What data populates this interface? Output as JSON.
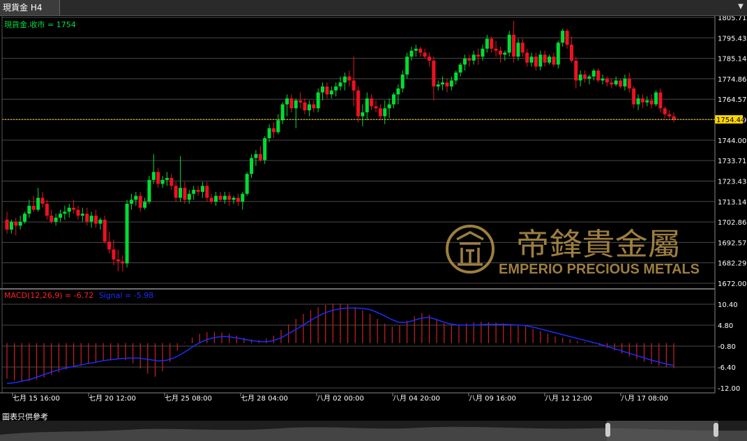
{
  "tab": {
    "title": "現貨金 H4",
    "scroll_icon": "chevron-down-icon"
  },
  "main_panel": {
    "legend": "現貨金.收市 = 1754",
    "current_price": "1754.44"
  },
  "macd_panel": {
    "macd_label": "MACD(12,26,9) = -6.72",
    "signal_label": "Signal = -5.98"
  },
  "watermark": {
    "chinese": "帝鋒貴金屬",
    "english": "EMPERIO PRECIOUS METALS",
    "logo_icon": "emperio-logo-icon"
  },
  "footer": {
    "label": "圖表只供參考"
  },
  "colors": {
    "up": "#00dd33",
    "down": "#ee1122",
    "grid": "#4a4a4a",
    "axis_text": "#ffffff",
    "price_tag": "#ffd700",
    "signal": "#1a2eff",
    "histogram": "#cc2222",
    "legend_main": "#00e040",
    "legend_macd": "#ff2020",
    "gold": "#b8944a"
  },
  "chart_data": [
    {
      "type": "candlestick",
      "title": "現貨金 H4",
      "ylim": [
        1672.0,
        1805.71
      ],
      "y_ticks": [
        "1805.71",
        "1795.43",
        "1785.14",
        "1774.86",
        "1764.57",
        "1754.29",
        "1744.00",
        "1733.71",
        "1723.43",
        "1713.14",
        "1702.86",
        "1692.57",
        "1682.29",
        "1672.00"
      ],
      "x_ticks": [
        "七月 15 16:00",
        "七月 20 12:00",
        "七月 25 08:00",
        "七月 28 04:00",
        "八月 02 00:00",
        "八月 04 20:00",
        "八月 09 16:00",
        "八月 12 12:00",
        "八月 17 08:00"
      ],
      "last_price": 1754.44,
      "candles": [
        [
          1704,
          1708,
          1697,
          1699
        ],
        [
          1699,
          1704,
          1697,
          1703
        ],
        [
          1703,
          1705,
          1696,
          1701
        ],
        [
          1701,
          1706,
          1699,
          1703
        ],
        [
          1703,
          1708,
          1702,
          1707
        ],
        [
          1707,
          1714,
          1705,
          1711
        ],
        [
          1711,
          1716,
          1708,
          1709
        ],
        [
          1709,
          1720,
          1708,
          1715
        ],
        [
          1715,
          1718,
          1710,
          1712
        ],
        [
          1712,
          1714,
          1704,
          1706
        ],
        [
          1706,
          1709,
          1702,
          1703
        ],
        [
          1703,
          1707,
          1701,
          1705
        ],
        [
          1705,
          1709,
          1703,
          1707
        ],
        [
          1707,
          1711,
          1704,
          1708
        ],
        [
          1708,
          1712,
          1705,
          1710
        ],
        [
          1710,
          1714,
          1707,
          1709
        ],
        [
          1709,
          1711,
          1704,
          1706
        ],
        [
          1706,
          1710,
          1703,
          1707
        ],
        [
          1707,
          1710,
          1701,
          1703
        ],
        [
          1703,
          1708,
          1700,
          1706
        ],
        [
          1706,
          1709,
          1700,
          1702
        ],
        [
          1702,
          1705,
          1699,
          1704
        ],
        [
          1704,
          1706,
          1692,
          1693
        ],
        [
          1693,
          1698,
          1687,
          1689
        ],
        [
          1689,
          1694,
          1681,
          1684
        ],
        [
          1684,
          1689,
          1678,
          1683
        ],
        [
          1683,
          1686,
          1678,
          1682
        ],
        [
          1682,
          1714,
          1680,
          1712
        ],
        [
          1712,
          1717,
          1709,
          1714
        ],
        [
          1714,
          1718,
          1711,
          1716
        ],
        [
          1716,
          1718,
          1708,
          1710
        ],
        [
          1710,
          1715,
          1709,
          1713
        ],
        [
          1713,
          1726,
          1712,
          1724
        ],
        [
          1724,
          1737,
          1722,
          1728
        ],
        [
          1728,
          1730,
          1720,
          1722
        ],
        [
          1722,
          1726,
          1720,
          1724
        ],
        [
          1724,
          1728,
          1721,
          1725
        ],
        [
          1725,
          1727,
          1719,
          1721
        ],
        [
          1721,
          1723,
          1713,
          1715
        ],
        [
          1715,
          1736,
          1713,
          1720
        ],
        [
          1720,
          1723,
          1712,
          1714
        ],
        [
          1714,
          1719,
          1712,
          1717
        ],
        [
          1717,
          1721,
          1714,
          1719
        ],
        [
          1719,
          1721,
          1716,
          1718
        ],
        [
          1718,
          1723,
          1715,
          1721
        ],
        [
          1721,
          1723,
          1713,
          1715
        ],
        [
          1715,
          1717,
          1712,
          1713
        ],
        [
          1713,
          1718,
          1711,
          1716
        ],
        [
          1716,
          1718,
          1713,
          1714
        ],
        [
          1714,
          1718,
          1712,
          1716
        ],
        [
          1716,
          1718,
          1711,
          1714
        ],
        [
          1714,
          1716,
          1712,
          1715
        ],
        [
          1715,
          1717,
          1711,
          1713
        ],
        [
          1713,
          1718,
          1709,
          1717
        ],
        [
          1717,
          1728,
          1716,
          1727
        ],
        [
          1727,
          1737,
          1725,
          1735
        ],
        [
          1735,
          1739,
          1731,
          1737
        ],
        [
          1737,
          1741,
          1733,
          1734
        ],
        [
          1734,
          1746,
          1732,
          1745
        ],
        [
          1745,
          1752,
          1743,
          1750
        ],
        [
          1750,
          1753,
          1745,
          1748
        ],
        [
          1748,
          1757,
          1747,
          1754
        ],
        [
          1754,
          1763,
          1752,
          1762
        ],
        [
          1762,
          1767,
          1756,
          1765
        ],
        [
          1765,
          1767,
          1758,
          1760
        ],
        [
          1760,
          1765,
          1750,
          1764
        ],
        [
          1764,
          1768,
          1760,
          1763
        ],
        [
          1763,
          1765,
          1757,
          1759
        ],
        [
          1759,
          1764,
          1756,
          1762
        ],
        [
          1762,
          1764,
          1758,
          1760
        ],
        [
          1760,
          1770,
          1758,
          1768
        ],
        [
          1768,
          1773,
          1764,
          1771
        ],
        [
          1771,
          1773,
          1765,
          1767
        ],
        [
          1767,
          1771,
          1765,
          1769
        ],
        [
          1769,
          1773,
          1766,
          1771
        ],
        [
          1771,
          1776,
          1769,
          1773
        ],
        [
          1773,
          1778,
          1769,
          1776
        ],
        [
          1776,
          1779,
          1771,
          1774
        ],
        [
          1774,
          1786,
          1761,
          1769
        ],
        [
          1769,
          1771,
          1753,
          1756
        ],
        [
          1756,
          1762,
          1751,
          1758
        ],
        [
          1758,
          1768,
          1754,
          1765
        ],
        [
          1765,
          1767,
          1759,
          1761
        ],
        [
          1761,
          1764,
          1758,
          1760
        ],
        [
          1760,
          1762,
          1754,
          1756
        ],
        [
          1756,
          1764,
          1752,
          1760
        ],
        [
          1760,
          1765,
          1755,
          1762
        ],
        [
          1762,
          1768,
          1760,
          1767
        ],
        [
          1767,
          1772,
          1762,
          1770
        ],
        [
          1770,
          1779,
          1768,
          1777
        ],
        [
          1777,
          1788,
          1775,
          1786
        ],
        [
          1786,
          1791,
          1784,
          1789
        ],
        [
          1789,
          1792,
          1786,
          1790
        ],
        [
          1790,
          1791,
          1786,
          1788
        ],
        [
          1788,
          1790,
          1785,
          1786
        ],
        [
          1786,
          1788,
          1781,
          1784
        ],
        [
          1784,
          1786,
          1764,
          1771
        ],
        [
          1771,
          1774,
          1769,
          1772
        ],
        [
          1772,
          1776,
          1769,
          1773
        ],
        [
          1773,
          1775,
          1768,
          1771
        ],
        [
          1771,
          1776,
          1769,
          1774
        ],
        [
          1774,
          1779,
          1772,
          1778
        ],
        [
          1778,
          1783,
          1776,
          1782
        ],
        [
          1782,
          1787,
          1779,
          1785
        ],
        [
          1785,
          1787,
          1781,
          1784
        ],
        [
          1784,
          1789,
          1782,
          1787
        ],
        [
          1787,
          1790,
          1782,
          1786
        ],
        [
          1786,
          1792,
          1784,
          1790
        ],
        [
          1790,
          1797,
          1788,
          1795
        ],
        [
          1795,
          1796,
          1788,
          1790
        ],
        [
          1790,
          1794,
          1786,
          1789
        ],
        [
          1789,
          1791,
          1783,
          1787
        ],
        [
          1787,
          1789,
          1784,
          1788
        ],
        [
          1788,
          1799,
          1786,
          1797
        ],
        [
          1797,
          1804,
          1783,
          1786
        ],
        [
          1786,
          1795,
          1784,
          1793
        ],
        [
          1793,
          1795,
          1786,
          1788
        ],
        [
          1788,
          1790,
          1781,
          1783
        ],
        [
          1783,
          1788,
          1781,
          1786
        ],
        [
          1786,
          1788,
          1779,
          1781
        ],
        [
          1781,
          1789,
          1779,
          1787
        ],
        [
          1787,
          1789,
          1781,
          1783
        ],
        [
          1783,
          1787,
          1782,
          1786
        ],
        [
          1786,
          1788,
          1781,
          1782
        ],
        [
          1782,
          1794,
          1780,
          1793
        ],
        [
          1793,
          1800,
          1791,
          1799
        ],
        [
          1799,
          1800,
          1790,
          1792
        ],
        [
          1792,
          1796,
          1783,
          1784
        ],
        [
          1784,
          1786,
          1770,
          1774
        ],
        [
          1774,
          1779,
          1771,
          1777
        ],
        [
          1777,
          1779,
          1773,
          1775
        ],
        [
          1775,
          1777,
          1772,
          1776
        ],
        [
          1776,
          1780,
          1774,
          1779
        ],
        [
          1779,
          1780,
          1773,
          1774
        ],
        [
          1774,
          1777,
          1772,
          1775
        ],
        [
          1775,
          1776,
          1771,
          1773
        ],
        [
          1773,
          1775,
          1770,
          1772
        ],
        [
          1772,
          1776,
          1771,
          1774
        ],
        [
          1774,
          1775,
          1770,
          1771
        ],
        [
          1771,
          1777,
          1769,
          1775
        ],
        [
          1775,
          1778,
          1768,
          1770
        ],
        [
          1770,
          1771,
          1760,
          1762
        ],
        [
          1762,
          1767,
          1759,
          1765
        ],
        [
          1765,
          1767,
          1760,
          1763
        ],
        [
          1763,
          1766,
          1761,
          1764
        ],
        [
          1764,
          1767,
          1760,
          1762
        ],
        [
          1762,
          1769,
          1761,
          1768
        ],
        [
          1768,
          1770,
          1758,
          1760
        ],
        [
          1760,
          1761,
          1755,
          1757
        ],
        [
          1757,
          1759,
          1755,
          1756
        ],
        [
          1756,
          1758,
          1753,
          1754.44
        ]
      ]
    },
    {
      "type": "macd",
      "title": "MACD(12,26,9)",
      "macd": -6.72,
      "signal": -5.98,
      "ylim": [
        -12.0,
        10.4
      ],
      "y_ticks": [
        "10.40",
        "4.80",
        "-0.80",
        "-6.40",
        "-12.00"
      ],
      "signal_series": [
        -10.8,
        -10.6,
        -10.2,
        -9.8,
        -9.2,
        -8.5,
        -7.8,
        -7.2,
        -6.7,
        -6.3,
        -5.9,
        -5.5,
        -5.2,
        -4.8,
        -4.5,
        -4.3,
        -4.1,
        -4.0,
        -4.0,
        -4.2,
        -4.5,
        -4.8,
        -4.6,
        -4.0,
        -3.0,
        -1.8,
        -0.5,
        0.5,
        1.2,
        1.6,
        1.8,
        1.6,
        1.3,
        0.9,
        0.6,
        0.4,
        0.4,
        0.8,
        1.6,
        2.7,
        3.8,
        5.0,
        6.2,
        7.3,
        8.2,
        8.8,
        9.2,
        9.4,
        9.4,
        9.3,
        9.0,
        8.3,
        7.4,
        6.4,
        5.6,
        5.5,
        6.0,
        6.6,
        6.9,
        6.5,
        5.8,
        5.2,
        4.9,
        4.8,
        4.8,
        4.9,
        5.0,
        5.0,
        5.0,
        5.0,
        4.9,
        4.8,
        4.5,
        4.1,
        3.6,
        3.1,
        2.6,
        2.1,
        1.6,
        1.1,
        0.6,
        0.1,
        -0.4,
        -1.0,
        -1.6,
        -2.2,
        -2.8,
        -3.4,
        -4.0,
        -4.6,
        -5.1,
        -5.6,
        -5.98
      ],
      "histogram": [
        -9.5,
        -10.0,
        -10.3,
        -10.2,
        -9.8,
        -9.2,
        -8.5,
        -7.8,
        -7.0,
        -6.5,
        -6.1,
        -5.6,
        -5.0,
        -4.6,
        -4.3,
        -4.3,
        -4.6,
        -5.4,
        -6.8,
        -8.2,
        -9.0,
        -7.5,
        -5.0,
        -2.0,
        0.2,
        1.5,
        2.5,
        2.9,
        3.0,
        2.8,
        2.5,
        2.0,
        1.4,
        1.0,
        0.8,
        1.2,
        2.0,
        3.5,
        5.0,
        6.5,
        7.8,
        8.8,
        9.6,
        10.2,
        10.6,
        10.6,
        10.3,
        9.6,
        8.8,
        7.8,
        6.5,
        5.2,
        4.4,
        4.8,
        6.0,
        7.2,
        8.0,
        7.6,
        6.4,
        5.3,
        4.8,
        5.0,
        5.3,
        5.6,
        5.7,
        5.6,
        5.5,
        5.3,
        5.1,
        4.8,
        4.4,
        3.8,
        3.2,
        2.5,
        1.8,
        1.4,
        1.0,
        0.6,
        0.3,
        -0.1,
        -0.6,
        -1.3,
        -2.0,
        -2.8,
        -3.6,
        -4.3,
        -5.0,
        -5.6,
        -6.1,
        -6.5,
        -6.72
      ]
    }
  ]
}
